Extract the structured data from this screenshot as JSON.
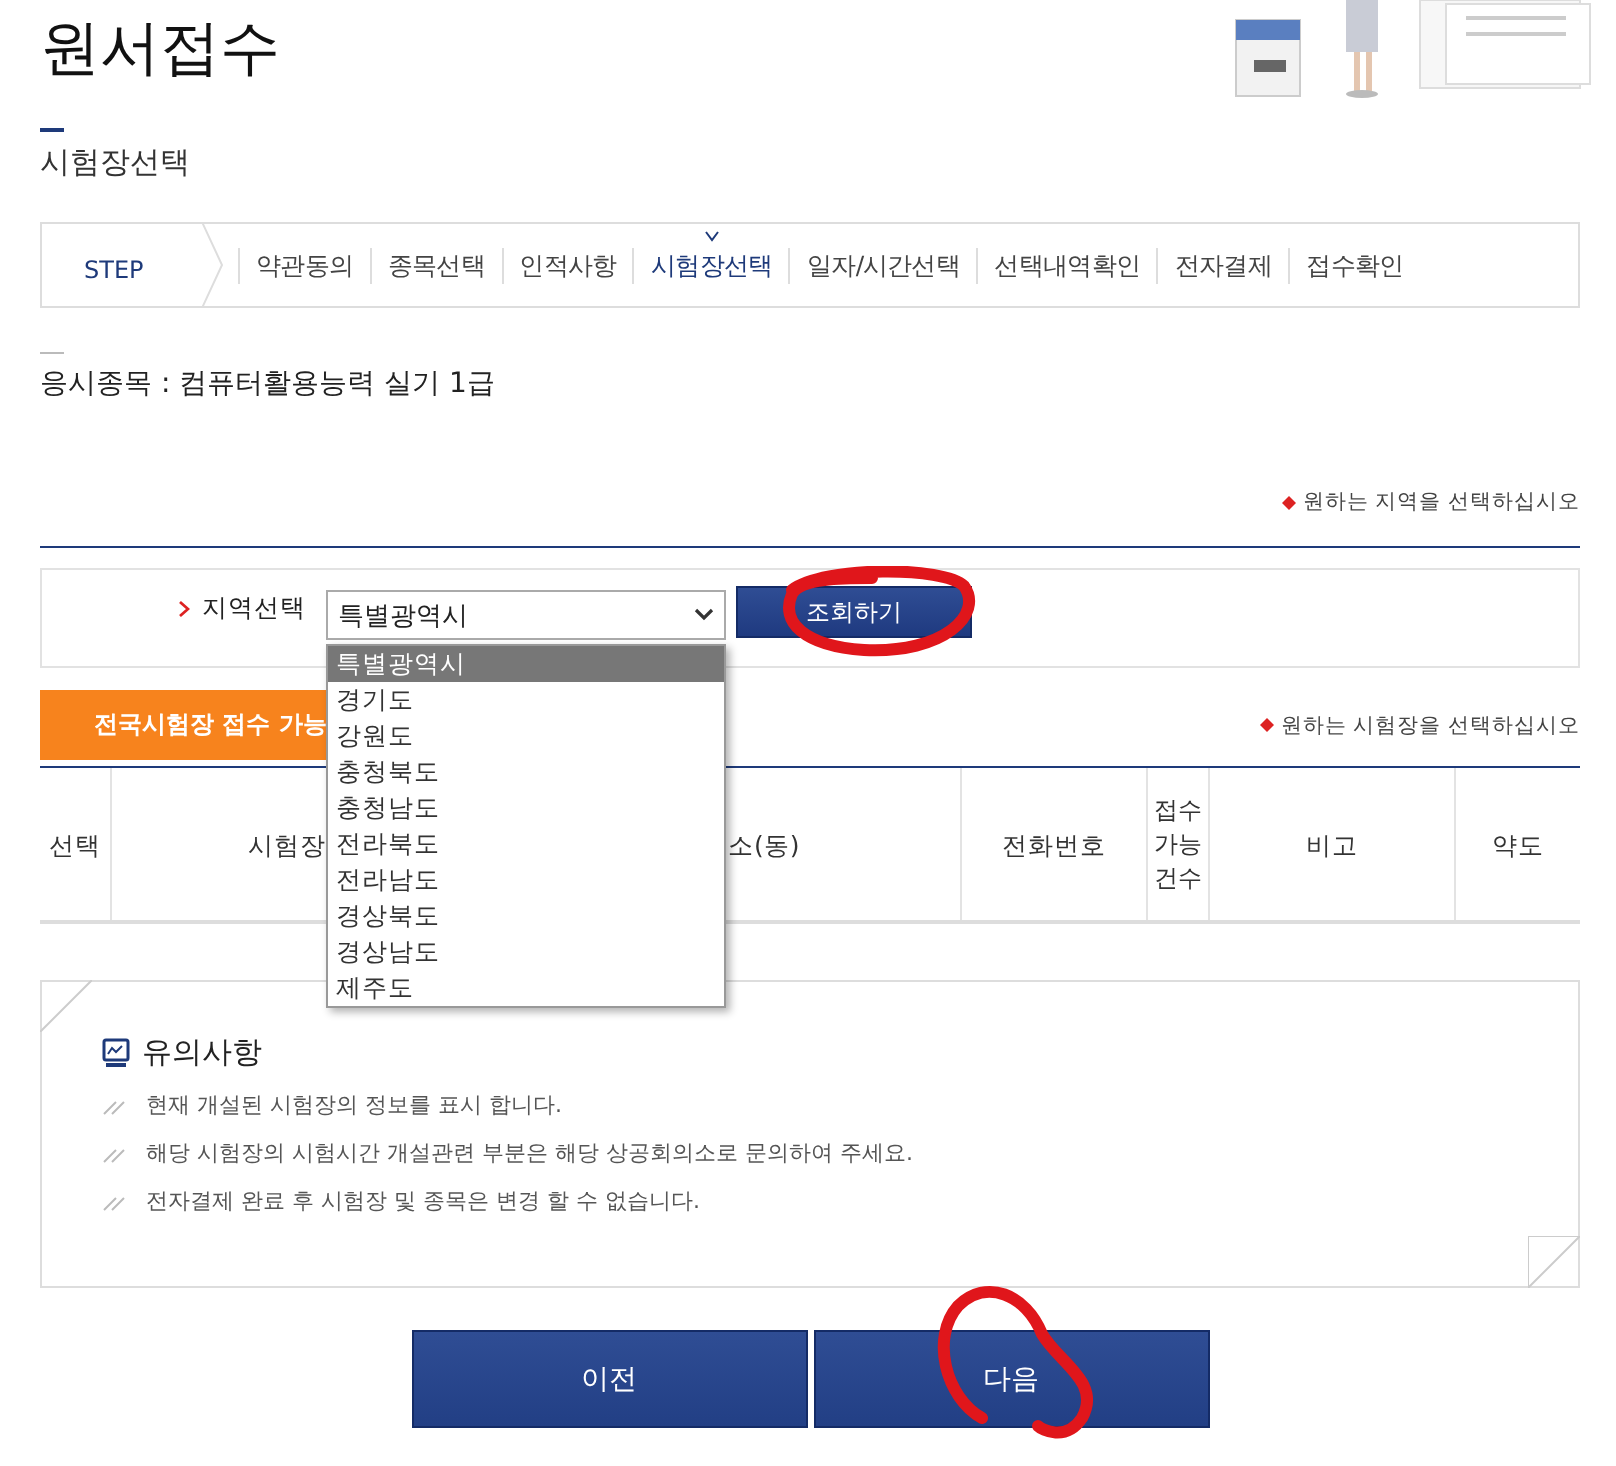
{
  "page_title": "원서접수",
  "section_title": "시험장선택",
  "steps": {
    "label": "STEP",
    "items": [
      {
        "label": "약관동의",
        "selected": false
      },
      {
        "label": "종목선택",
        "selected": false
      },
      {
        "label": "인적사항",
        "selected": false
      },
      {
        "label": "시험장선택",
        "selected": true
      },
      {
        "label": "일자/시간선택",
        "selected": false
      },
      {
        "label": "선택내역확인",
        "selected": false
      },
      {
        "label": "전자결제",
        "selected": false
      },
      {
        "label": "접수확인",
        "selected": false
      }
    ]
  },
  "exam_subject": "응시종목 : 컴퓨터활용능력 실기 1급",
  "region_hint": "원하는 지역을 선택하십시오",
  "region": {
    "label": "지역선택",
    "value": "특별광역시",
    "search_button": {
      "label": "조회하기",
      "circled": true
    },
    "options": [
      {
        "label": "특별광역시",
        "selected": true
      },
      {
        "label": "경기도",
        "selected": false
      },
      {
        "label": "강원도",
        "selected": false
      },
      {
        "label": "충청북도",
        "selected": false
      },
      {
        "label": "충청남도",
        "selected": false
      },
      {
        "label": "전라북도",
        "selected": false
      },
      {
        "label": "전라남도",
        "selected": false
      },
      {
        "label": "경상북도",
        "selected": false
      },
      {
        "label": "경상남도",
        "selected": false
      },
      {
        "label": "제주도",
        "selected": false
      }
    ]
  },
  "centers_tab": "전국시험장 접수 가능",
  "centers_hint": "원하는 시험장을 선택하십시오",
  "table": {
    "columns": [
      "선택",
      "시험장",
      "소(동)",
      "전화번호",
      "접수 가능 건수",
      "비고",
      "약도"
    ]
  },
  "notice": {
    "title": "유의사항",
    "items": [
      "현재 개설된 시험장의 정보를 표시 합니다.",
      "해당 시험장의 시험시간 개설관련 부분은 해당 상공회의소로 문의하여 주세요.",
      "전자결제 완료 후 시험장 및 종목은 변경 할 수 없습니다."
    ]
  },
  "buttons": [
    {
      "label": "이전",
      "circled": false
    },
    {
      "label": "다음",
      "circled": true
    }
  ]
}
